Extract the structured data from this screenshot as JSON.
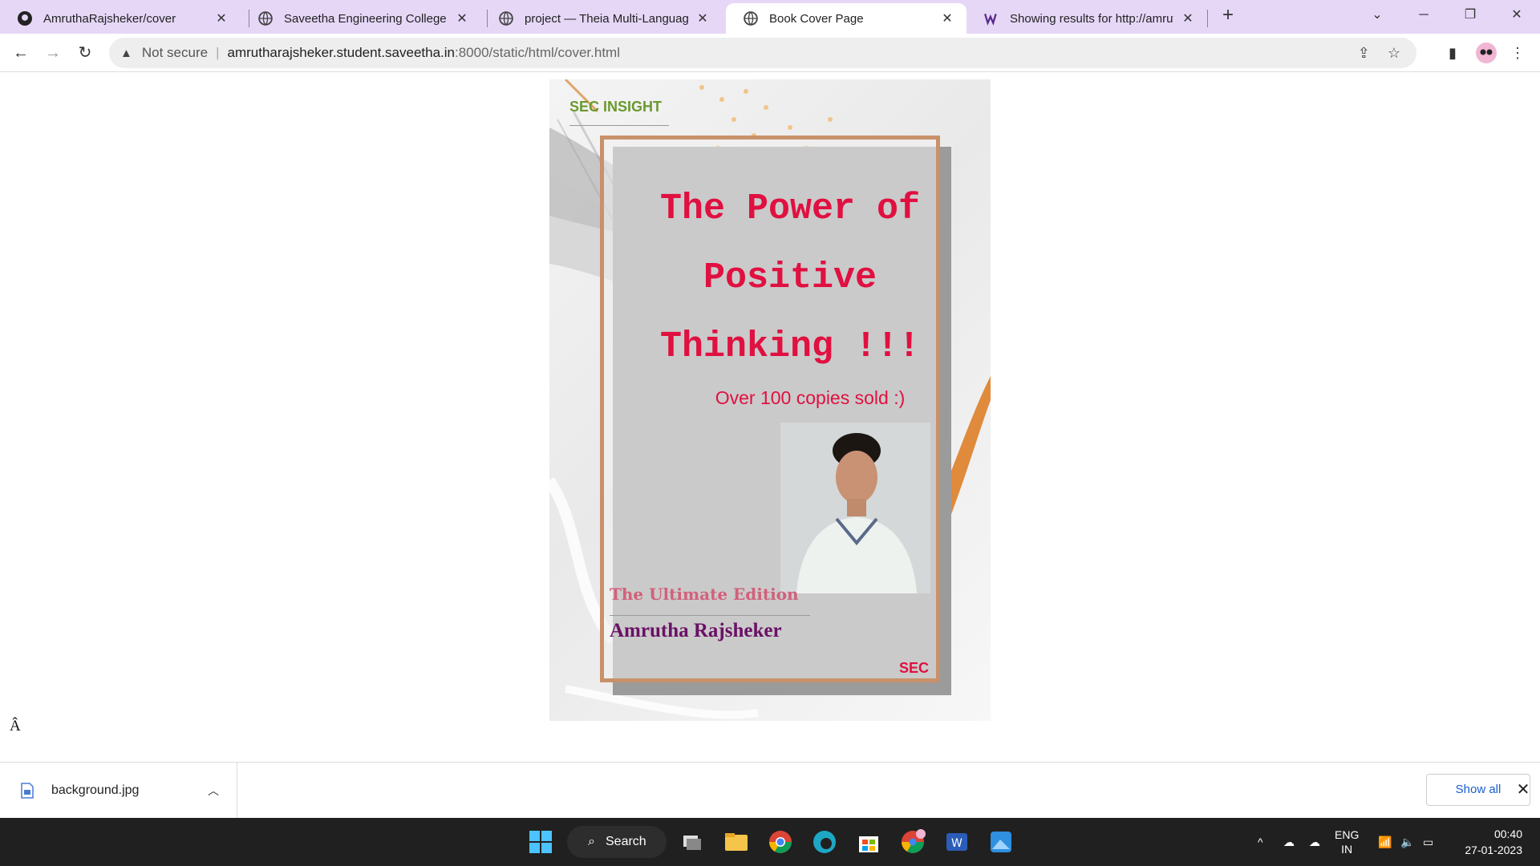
{
  "browser": {
    "tabs": [
      {
        "title": "AmruthaRajsheker/cover",
        "icon": "github-icon",
        "active": false
      },
      {
        "title": "Saveetha Engineering College",
        "icon": "globe-icon",
        "active": false
      },
      {
        "title": "project — Theia Multi-Language",
        "icon": "globe-icon",
        "active": false
      },
      {
        "title": "Book Cover Page",
        "icon": "globe-icon",
        "active": true
      },
      {
        "title": "Showing results for http://amruth",
        "icon": "wappalyzer-icon",
        "active": false
      }
    ],
    "new_tab_label": "+",
    "address_bar": {
      "security_label": "Not secure",
      "host": "amrutharajsheker.student.saveetha.in",
      "path": ":8000/static/html/cover.html"
    }
  },
  "page": {
    "brand_top": "SEC INSIGHT",
    "title_lines": [
      "The Power of",
      "Positive",
      "Thinking !!!"
    ],
    "sales_text": "Over 100 copies sold :)",
    "edition": "The Ultimate Edition",
    "author": "Amrutha Rajsheker",
    "brand_bottom": "SEC",
    "stray_char": "Â",
    "colors": {
      "title": "#e01040",
      "brand_top": "#6a9930",
      "edition": "#d2607a",
      "author": "#6a1066",
      "frame": "#c8916a"
    }
  },
  "downloads": {
    "file_name": "background.jpg",
    "show_all_label": "Show all"
  },
  "taskbar": {
    "search_label": "Search",
    "language": "ENG",
    "region": "IN",
    "time": "00:40",
    "date": "27-01-2023"
  }
}
